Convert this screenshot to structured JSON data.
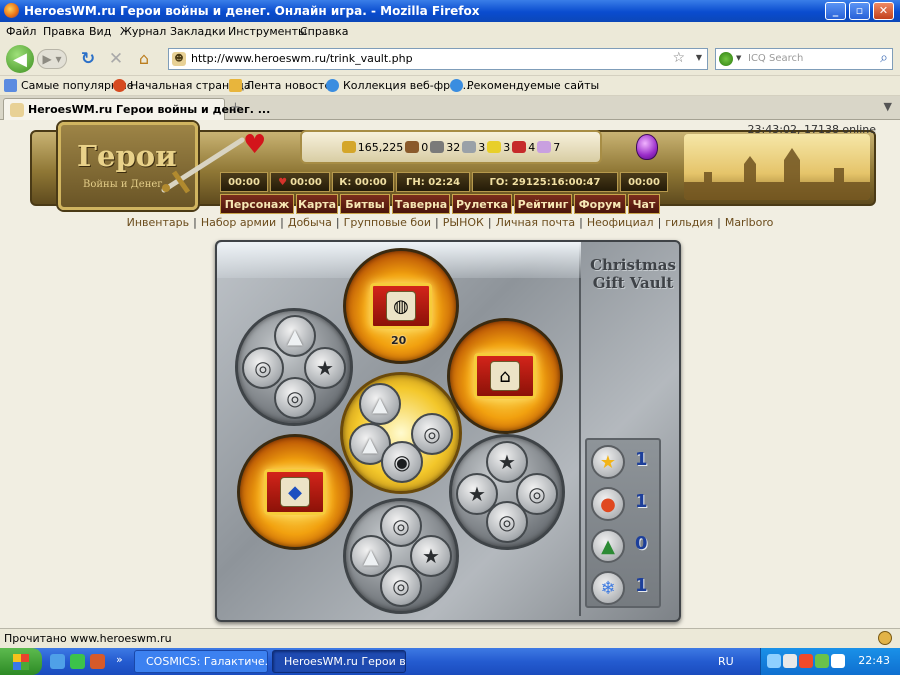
{
  "window": {
    "title": "HeroesWM.ru Герои войны и денег. Онлайн игра. - Mozilla Firefox",
    "buttons": {
      "minimize": "_",
      "maximize": "▫",
      "close": "✕"
    }
  },
  "menu": [
    "Файл",
    "Правка",
    "Вид",
    "Журнал",
    "Закладки",
    "Инструменты",
    "Справка"
  ],
  "nav": {
    "url": "http://www.heroeswm.ru/trink_vault.php",
    "search_placeholder": "ICQ Search"
  },
  "bookmarks": [
    {
      "label": "Самые популярные",
      "icon": "bookmark-page-icon",
      "color": "#5b8be0"
    },
    {
      "label": "Начальная страница",
      "icon": "firefox-home-icon",
      "color": "#d64a20"
    },
    {
      "label": "Лента новостей",
      "icon": "rss-folder-icon",
      "color": "#e8b53c"
    },
    {
      "label": "Коллекция веб-фраг...",
      "icon": "ie-icon",
      "color": "#3a8de0"
    },
    {
      "label": "Рекомендуемые сайты",
      "icon": "ie-icon",
      "color": "#3a8de0"
    }
  ],
  "tabs": [
    {
      "label": "HeroesWM.ru Герои войны и денег. ..."
    }
  ],
  "game": {
    "logo": {
      "line1": "Герои",
      "line2": "Войны и Денег"
    },
    "server_info": "23:43:02, 17138 online",
    "resources": [
      {
        "name": "gold",
        "value": "165,225",
        "color": "#d4a62a"
      },
      {
        "name": "wood",
        "value": "0",
        "color": "#8a5a2b"
      },
      {
        "name": "ore",
        "value": "32",
        "color": "#7a7a7a"
      },
      {
        "name": "mercury",
        "value": "3",
        "color": "#9aa1a8"
      },
      {
        "name": "sulfur",
        "value": "3",
        "color": "#e8cf2a"
      },
      {
        "name": "crystals",
        "value": "4",
        "color": "#c62a2a"
      },
      {
        "name": "gems",
        "value": "7",
        "color": "#c9a0e0"
      }
    ],
    "timers": [
      {
        "label": "00:00",
        "heart": false
      },
      {
        "label": "00:00",
        "heart": true
      },
      {
        "label": "К: 00:00",
        "heart": false
      },
      {
        "label": "ГН: 02:24",
        "heart": false
      },
      {
        "label": "ГО: 29125:16:00:47",
        "heart": false
      },
      {
        "label": "00:00",
        "heart": false
      }
    ],
    "nav": [
      "Персонаж",
      "Карта",
      "Битвы",
      "Таверна",
      "Рулетка",
      "Рейтинг",
      "Форум",
      "Чат"
    ],
    "sublinks": [
      "Инвентарь",
      "Набор армии",
      "Добыча",
      "Групповые бои",
      "РЫНОК",
      "Личная почта",
      "Неофициал",
      "гильдия",
      "Marlboro"
    ]
  },
  "vault": {
    "title_line1": "Christmas",
    "title_line2": "Gift Vault",
    "counters": [
      {
        "name": "star",
        "glyph": "★",
        "color": "#f2b418",
        "value": "1"
      },
      {
        "name": "lantern",
        "glyph": "●",
        "color": "#e0481f",
        "value": "1"
      },
      {
        "name": "tree",
        "glyph": "▲",
        "color": "#2c8a34",
        "value": "0"
      },
      {
        "name": "snowflake",
        "glyph": "❄",
        "color": "#3d7ae0",
        "value": "1"
      }
    ],
    "glyphs": {
      "tree": "▲",
      "lantern": "◎",
      "star": "★",
      "sphere": "◉"
    },
    "chest_count": "20",
    "chest_items": {
      "ore": "◍",
      "helmet": "⌂",
      "shield": "◆"
    }
  },
  "status": {
    "text": "Прочитано www.heroeswm.ru"
  },
  "taskbar": {
    "tasks": [
      {
        "label": "COSMICS: Галактиче..."
      },
      {
        "label": "HeroesWM.ru Герои в..."
      }
    ],
    "lang": "RU",
    "clock": "22:43"
  }
}
